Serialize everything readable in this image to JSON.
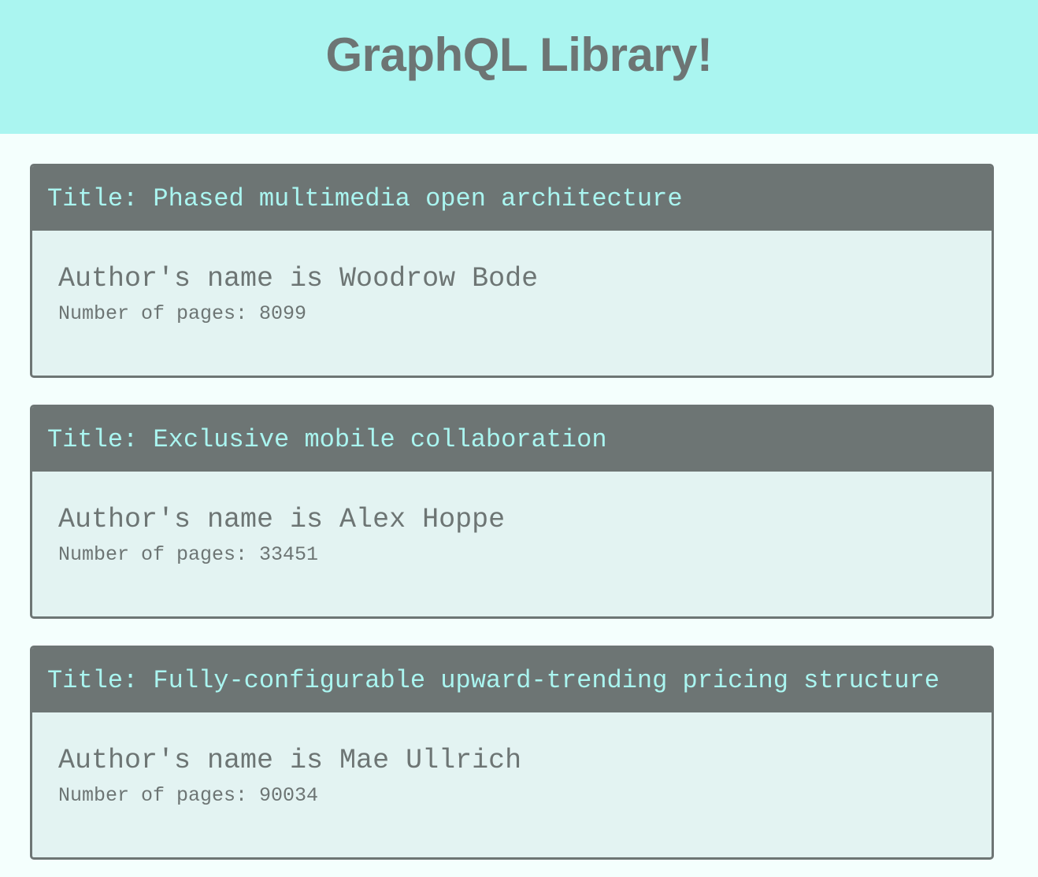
{
  "header": {
    "title": "GraphQL Library!"
  },
  "books": [
    {
      "title_line": "Title: Phased multimedia open architecture",
      "author_line": "Author's name is Woodrow Bode",
      "pages_line": "Number of pages: 8099"
    },
    {
      "title_line": "Title: Exclusive mobile collaboration",
      "author_line": "Author's name is Alex Hoppe",
      "pages_line": "Number of pages: 33451"
    },
    {
      "title_line": "Title: Fully-configurable upward-trending pricing structure",
      "author_line": "Author's name is Mae Ullrich",
      "pages_line": "Number of pages: 90034"
    }
  ],
  "colors": {
    "header_bg": "#aaf5f0",
    "accent_gray": "#6d7574",
    "card_bg": "#e3f3f2",
    "page_bg": "#f4fffd"
  }
}
